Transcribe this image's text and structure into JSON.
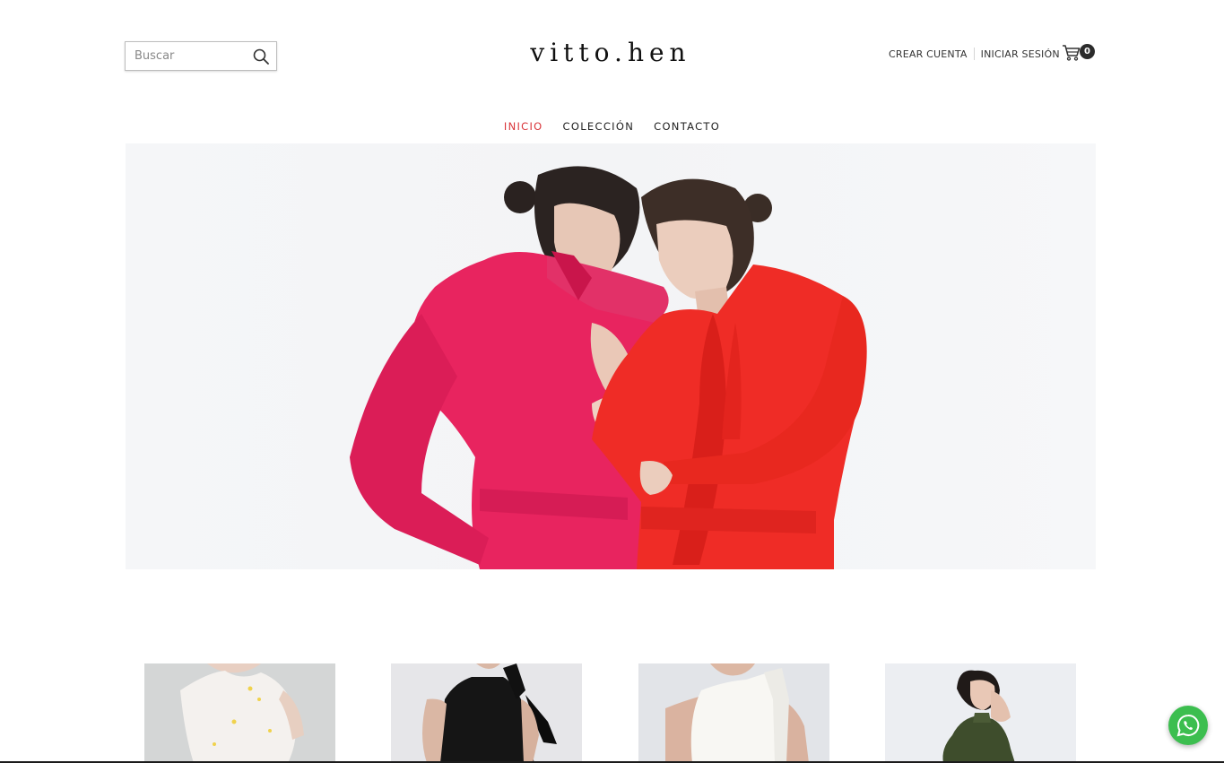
{
  "search": {
    "placeholder": "Buscar"
  },
  "logo": {
    "text": "vitto.hen"
  },
  "account": {
    "create_label": "CREAR CUENTA",
    "login_label": "INICIAR SESIÓN"
  },
  "cart": {
    "count": "0"
  },
  "nav": {
    "items": [
      {
        "label": "INICIO",
        "active": true
      },
      {
        "label": "COLECCIÓN",
        "active": false
      },
      {
        "label": "CONTACTO",
        "active": false
      }
    ]
  },
  "colors": {
    "accent": "#d9353a",
    "whatsapp": "#3cbe4f",
    "pink_shirt": "#e8245f",
    "red_shirt": "#ef2c26"
  },
  "hero": {
    "image": "two-models-pink-red-shirts"
  },
  "products": [
    {
      "image": "white-embroidered-top"
    },
    {
      "image": "black-halter-top"
    },
    {
      "image": "white-halter-top"
    },
    {
      "image": "green-halter-top"
    }
  ],
  "icons": [
    "search-icon",
    "cart-icon",
    "whatsapp-icon"
  ]
}
